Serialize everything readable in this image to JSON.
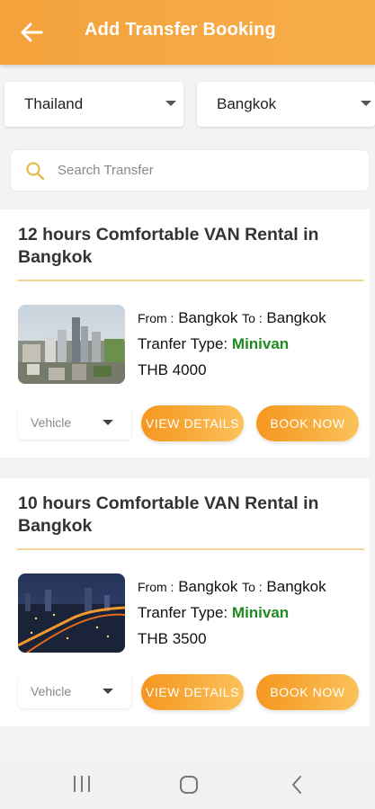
{
  "header": {
    "title": "Add Transfer Booking",
    "back_icon": "arrow-left-icon"
  },
  "filters": {
    "country": "Thailand",
    "city": "Bangkok"
  },
  "search": {
    "placeholder": "Search Transfer",
    "value": "",
    "icon": "search-icon"
  },
  "transfers": [
    {
      "title": "12 hours Comfortable VAN Rental in Bangkok",
      "from_label": "From :",
      "from": "Bangkok",
      "to_label": "To :",
      "to": "Bangkok",
      "type_label": "Tranfer Type:",
      "type": "Minivan",
      "price": "THB 4000",
      "vehicle_placeholder": "Vehicle",
      "details_label": "VIEW DETAILS",
      "book_label": "BOOK NOW"
    },
    {
      "title": "10 hours Comfortable VAN Rental in Bangkok",
      "from_label": "From :",
      "from": "Bangkok",
      "to_label": "To :",
      "to": "Bangkok",
      "type_label": "Tranfer Type:",
      "type": "Minivan",
      "price": "THB 3500",
      "vehicle_placeholder": "Vehicle",
      "details_label": "VIEW DETAILS",
      "book_label": "BOOK NOW"
    }
  ],
  "colors": {
    "accent": "#f4a23c",
    "type_green": "#1f8a1f",
    "divider": "#f0d89a"
  },
  "system_nav": {
    "recents_icon": "recents-icon",
    "home_icon": "home-icon",
    "back_icon": "back-chevron-icon"
  }
}
